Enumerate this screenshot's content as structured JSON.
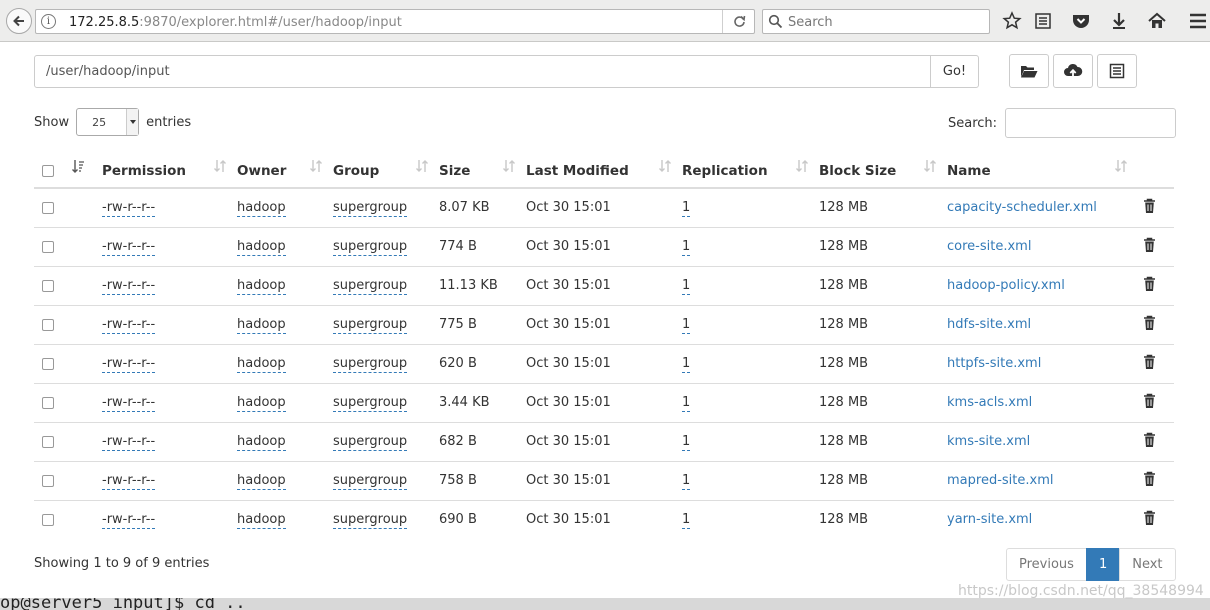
{
  "browser": {
    "url_host": "172.25.8.5",
    "url_rest": ":9870/explorer.html#/user/hadoop/input",
    "search_placeholder": "Search"
  },
  "explorer": {
    "path_value": "/user/hadoop/input",
    "go_label": "Go!"
  },
  "table_controls": {
    "show_label": "Show",
    "entries_value": "25",
    "entries_label": "entries",
    "search_label": "Search:"
  },
  "columns": [
    "Permission",
    "Owner",
    "Group",
    "Size",
    "Last Modified",
    "Replication",
    "Block Size",
    "Name"
  ],
  "rows": [
    {
      "permission": "-rw-r--r--",
      "owner": "hadoop",
      "group": "supergroup",
      "size": "8.07 KB",
      "modified": "Oct 30 15:01",
      "replication": "1",
      "block_size": "128 MB",
      "name": "capacity-scheduler.xml"
    },
    {
      "permission": "-rw-r--r--",
      "owner": "hadoop",
      "group": "supergroup",
      "size": "774 B",
      "modified": "Oct 30 15:01",
      "replication": "1",
      "block_size": "128 MB",
      "name": "core-site.xml"
    },
    {
      "permission": "-rw-r--r--",
      "owner": "hadoop",
      "group": "supergroup",
      "size": "11.13 KB",
      "modified": "Oct 30 15:01",
      "replication": "1",
      "block_size": "128 MB",
      "name": "hadoop-policy.xml"
    },
    {
      "permission": "-rw-r--r--",
      "owner": "hadoop",
      "group": "supergroup",
      "size": "775 B",
      "modified": "Oct 30 15:01",
      "replication": "1",
      "block_size": "128 MB",
      "name": "hdfs-site.xml"
    },
    {
      "permission": "-rw-r--r--",
      "owner": "hadoop",
      "group": "supergroup",
      "size": "620 B",
      "modified": "Oct 30 15:01",
      "replication": "1",
      "block_size": "128 MB",
      "name": "httpfs-site.xml"
    },
    {
      "permission": "-rw-r--r--",
      "owner": "hadoop",
      "group": "supergroup",
      "size": "3.44 KB",
      "modified": "Oct 30 15:01",
      "replication": "1",
      "block_size": "128 MB",
      "name": "kms-acls.xml"
    },
    {
      "permission": "-rw-r--r--",
      "owner": "hadoop",
      "group": "supergroup",
      "size": "682 B",
      "modified": "Oct 30 15:01",
      "replication": "1",
      "block_size": "128 MB",
      "name": "kms-site.xml"
    },
    {
      "permission": "-rw-r--r--",
      "owner": "hadoop",
      "group": "supergroup",
      "size": "758 B",
      "modified": "Oct 30 15:01",
      "replication": "1",
      "block_size": "128 MB",
      "name": "mapred-site.xml"
    },
    {
      "permission": "-rw-r--r--",
      "owner": "hadoop",
      "group": "supergroup",
      "size": "690 B",
      "modified": "Oct 30 15:01",
      "replication": "1",
      "block_size": "128 MB",
      "name": "yarn-site.xml"
    }
  ],
  "footer": {
    "info": "Showing 1 to 9 of 9 entries",
    "previous": "Previous",
    "current_page": "1",
    "next": "Next"
  },
  "background_terminal": "op@server5 input]$ cd ..",
  "watermark": "https://blog.csdn.net/qq_38548994",
  "colors": {
    "link": "#337ab7",
    "pager_active": "#337ab7"
  }
}
